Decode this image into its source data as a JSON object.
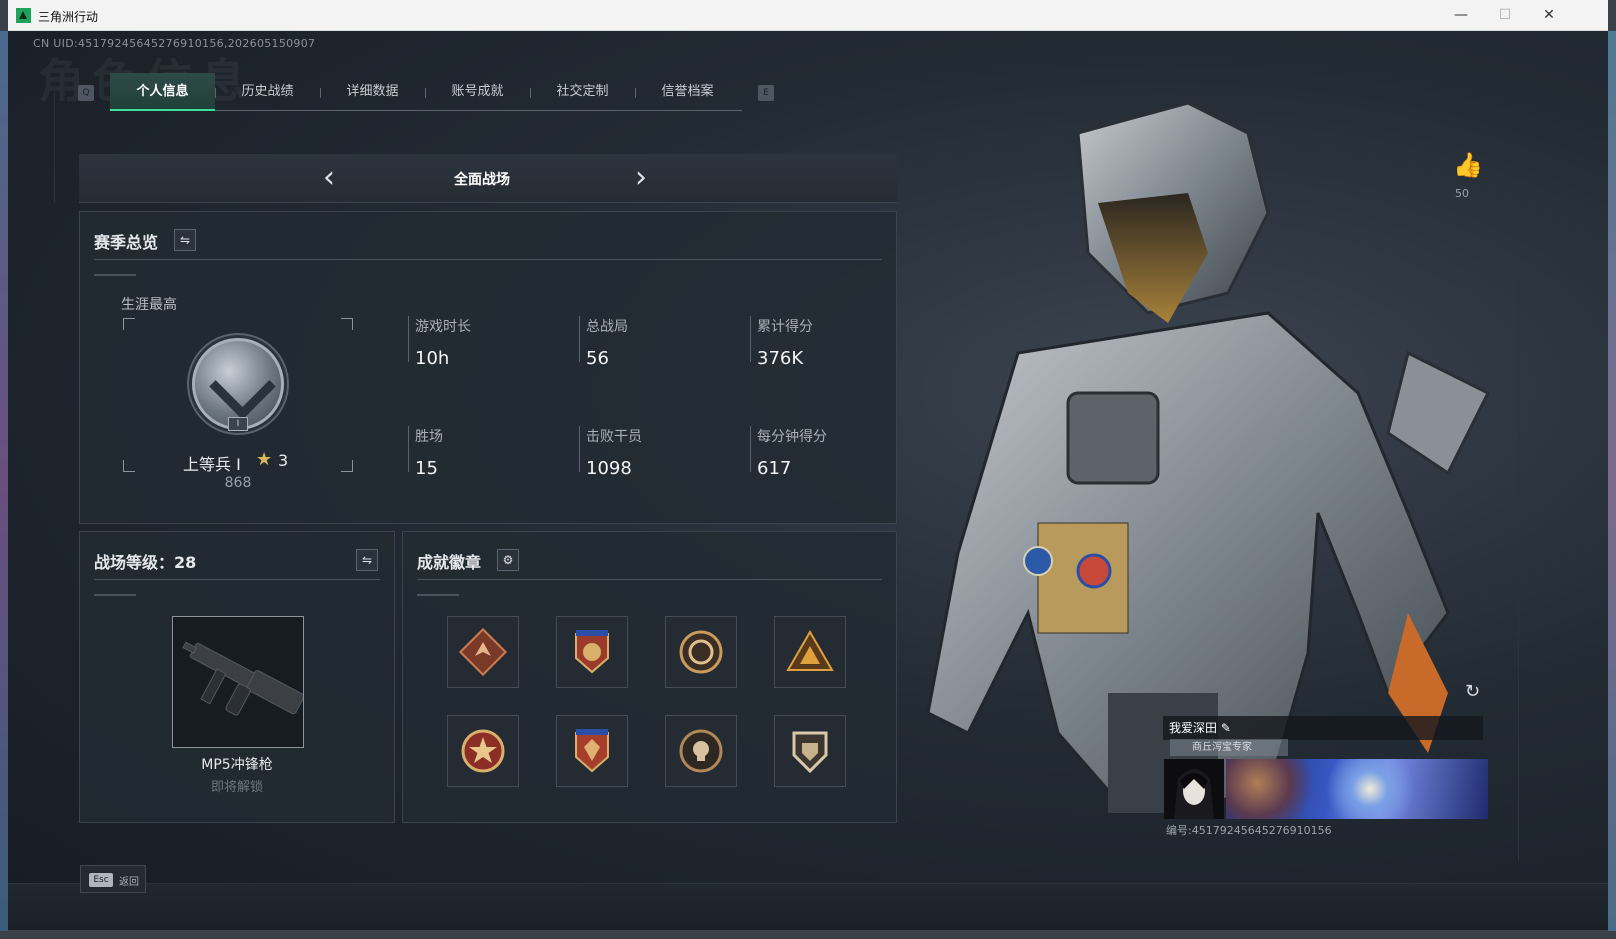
{
  "window": {
    "title": "三角洲行动",
    "minimize": "—",
    "maximize": "☐",
    "close": "✕"
  },
  "uid_line": "CN UID:4517924564527691015​6,202605150907",
  "ghost_title": "角色信息",
  "tabs": [
    {
      "label": "个人信息",
      "active": true
    },
    {
      "label": "历史战绩",
      "active": false
    },
    {
      "label": "详细数据",
      "active": false
    },
    {
      "label": "账号成就",
      "active": false
    },
    {
      "label": "社交定制",
      "active": false
    },
    {
      "label": "信誉档案",
      "active": false
    }
  ],
  "tab_keys": {
    "prev": "Q",
    "next": "E"
  },
  "mode": {
    "label": "全面战场",
    "prev_icon": "‹",
    "next_icon": "›"
  },
  "season": {
    "title": "赛季总览",
    "switch_icon": "⇋",
    "career_label": "生涯最高",
    "rank_badge_icon": "rank-chevron-icon",
    "rank_sub": "I",
    "rank_name": "上等兵 I",
    "rank_stars": "3",
    "rank_score": "868",
    "stats": [
      {
        "label": "游戏时长",
        "value": "10h"
      },
      {
        "label": "总战局",
        "value": "56"
      },
      {
        "label": "累计得分",
        "value": "376K"
      },
      {
        "label": "胜场",
        "value": "15"
      },
      {
        "label": "击败干员",
        "value": "1098"
      },
      {
        "label": "每分钟得分",
        "value": "617"
      }
    ]
  },
  "battlefield": {
    "title": "战场等级：28",
    "switch_icon": "⇋",
    "weapon_name": "MP5冲锋枪",
    "weapon_status": "即将解锁"
  },
  "badges": {
    "title": "成就徽章",
    "settings_icon": "⚙",
    "items": [
      {
        "icon": "dragon-badge-icon",
        "color": "#b5533a"
      },
      {
        "icon": "shield-medal-badge-icon",
        "color": "#c9573d"
      },
      {
        "icon": "ring-badge-icon",
        "color": "#b58a4d"
      },
      {
        "icon": "warning-badge-icon",
        "color": "#c98d2f"
      },
      {
        "icon": "star-badge-icon",
        "color": "#c74a3a"
      },
      {
        "icon": "crest-badge-icon",
        "color": "#c9573d"
      },
      {
        "icon": "skull-badge-icon",
        "color": "#a07a52"
      },
      {
        "icon": "shield-badge-icon",
        "color": "#b8a07a"
      }
    ]
  },
  "likes": {
    "icon": "thumbs-up-icon",
    "count": "50"
  },
  "player_card": {
    "name": "我爱深田",
    "club": "商丘泻宝专家",
    "uid": "编号:4517924564527691015​6"
  },
  "esc": {
    "key": "Esc",
    "label": "返回"
  },
  "colors": {
    "accent": "#3ddf9a",
    "panel": "#222a33",
    "background": "#161c23"
  }
}
